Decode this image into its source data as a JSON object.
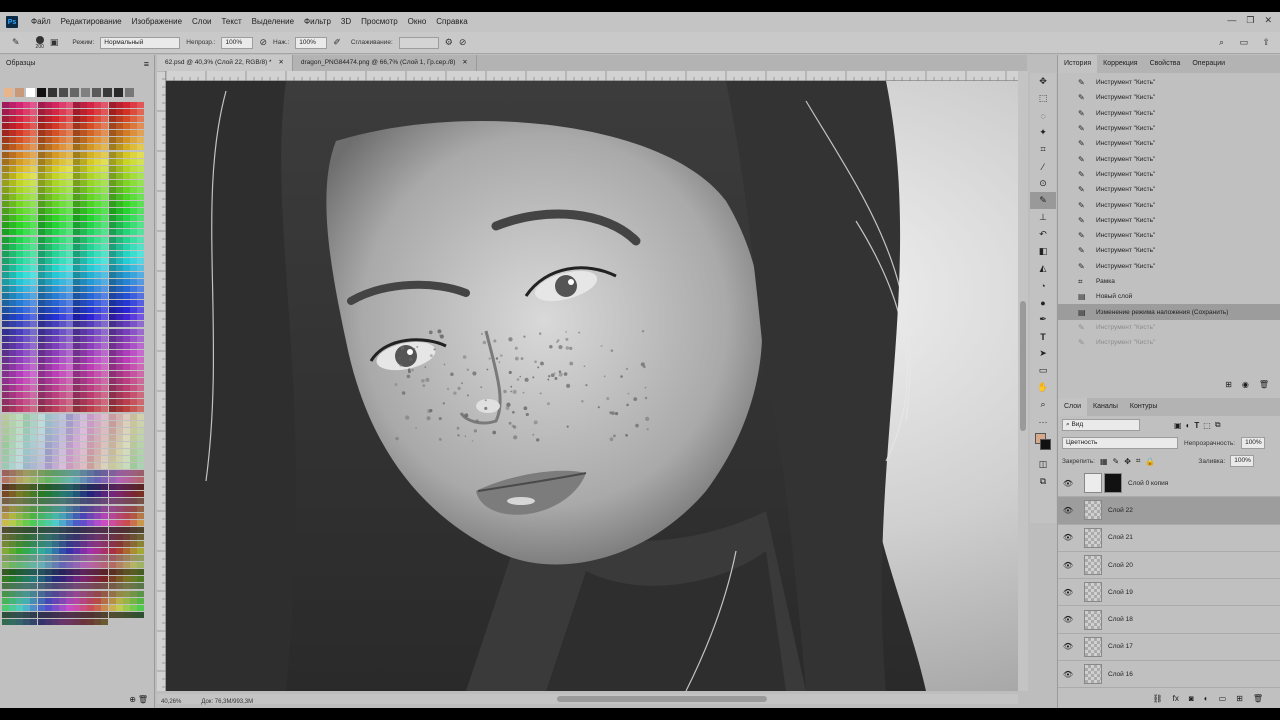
{
  "app": {
    "logo": "Ps",
    "menu": [
      "Файл",
      "Редактирование",
      "Изображение",
      "Слои",
      "Текст",
      "Выделение",
      "Фильтр",
      "3D",
      "Просмотр",
      "Окно",
      "Справка"
    ],
    "window_controls": [
      "—",
      "❐",
      "✕"
    ]
  },
  "options": {
    "brush_size": "200",
    "mode_label": "Режим:",
    "mode_value": "Нормальный",
    "opacity_label": "Непрозр.:",
    "opacity_value": "100%",
    "pressure_label": "Наж.:",
    "pressure_value": "100%",
    "smoothing_label": "Сглаживание:"
  },
  "swatches": {
    "title": "Образцы",
    "top_row": [
      "#e8b48a",
      "#c99a7a",
      "#ffffff",
      "#111111",
      "#333333",
      "#4d4d4d",
      "#666666",
      "#808080",
      "#5a5a5a",
      "#3a3a3a",
      "#2a2a2a",
      "#777777"
    ]
  },
  "documents": {
    "tabs": [
      {
        "title": "62.psd @ 40,3% (Слой 22, RGB/8) *",
        "close": "✕",
        "active": true
      },
      {
        "title": "dragon_PNG84474.png @ 66,7% (Слой 1, Гр.сер./8)",
        "close": "✕",
        "active": false
      }
    ]
  },
  "status": {
    "zoom": "40,26%",
    "doc": "Док: 76,3M/993,3M"
  },
  "history": {
    "tabs": [
      "История",
      "Коррекция",
      "Свойства",
      "Операции"
    ],
    "items": [
      {
        "label": "Инструмент \"Кисть\"",
        "icon": "brush-icon",
        "state": ""
      },
      {
        "label": "Инструмент \"Кисть\"",
        "icon": "brush-icon",
        "state": ""
      },
      {
        "label": "Инструмент \"Кисть\"",
        "icon": "brush-icon",
        "state": ""
      },
      {
        "label": "Инструмент \"Кисть\"",
        "icon": "brush-icon",
        "state": ""
      },
      {
        "label": "Инструмент \"Кисть\"",
        "icon": "brush-icon",
        "state": ""
      },
      {
        "label": "Инструмент \"Кисть\"",
        "icon": "brush-icon",
        "state": ""
      },
      {
        "label": "Инструмент \"Кисть\"",
        "icon": "brush-icon",
        "state": ""
      },
      {
        "label": "Инструмент \"Кисть\"",
        "icon": "brush-icon",
        "state": ""
      },
      {
        "label": "Инструмент \"Кисть\"",
        "icon": "brush-icon",
        "state": ""
      },
      {
        "label": "Инструмент \"Кисть\"",
        "icon": "brush-icon",
        "state": ""
      },
      {
        "label": "Инструмент \"Кисть\"",
        "icon": "brush-icon",
        "state": ""
      },
      {
        "label": "Инструмент \"Кисть\"",
        "icon": "brush-icon",
        "state": ""
      },
      {
        "label": "Инструмент \"Кисть\"",
        "icon": "brush-icon",
        "state": ""
      },
      {
        "label": "Рамка",
        "icon": "crop-icon",
        "state": ""
      },
      {
        "label": "Новый слой",
        "icon": "layer-icon",
        "state": ""
      },
      {
        "label": "Изменение режима наложения (Сохранить)",
        "icon": "layer-icon",
        "state": "sel"
      },
      {
        "label": "Инструмент \"Кисть\"",
        "icon": "brush-icon",
        "state": "dim"
      },
      {
        "label": "Инструмент \"Кисть\"",
        "icon": "brush-icon",
        "state": "dim"
      }
    ]
  },
  "layers": {
    "tabs": [
      "Слои",
      "Каналы",
      "Контуры"
    ],
    "filter_label": "Вид",
    "blend_mode": "Цветность",
    "opacity_label": "Непрозрачность:",
    "opacity_value": "100%",
    "lock_label": "Закрепить:",
    "fill_label": "Заливка:",
    "fill_value": "100%",
    "items": [
      {
        "name": "Слой 0 копия",
        "selected": false,
        "mask": true
      },
      {
        "name": "Слой 22",
        "selected": true,
        "mask": false
      },
      {
        "name": "Слой 21",
        "selected": false,
        "mask": false
      },
      {
        "name": "Слой 20",
        "selected": false,
        "mask": false
      },
      {
        "name": "Слой 19",
        "selected": false,
        "mask": false
      },
      {
        "name": "Слой 18",
        "selected": false,
        "mask": false
      },
      {
        "name": "Слой 17",
        "selected": false,
        "mask": false
      },
      {
        "name": "Слой 16",
        "selected": false,
        "mask": false
      }
    ]
  }
}
